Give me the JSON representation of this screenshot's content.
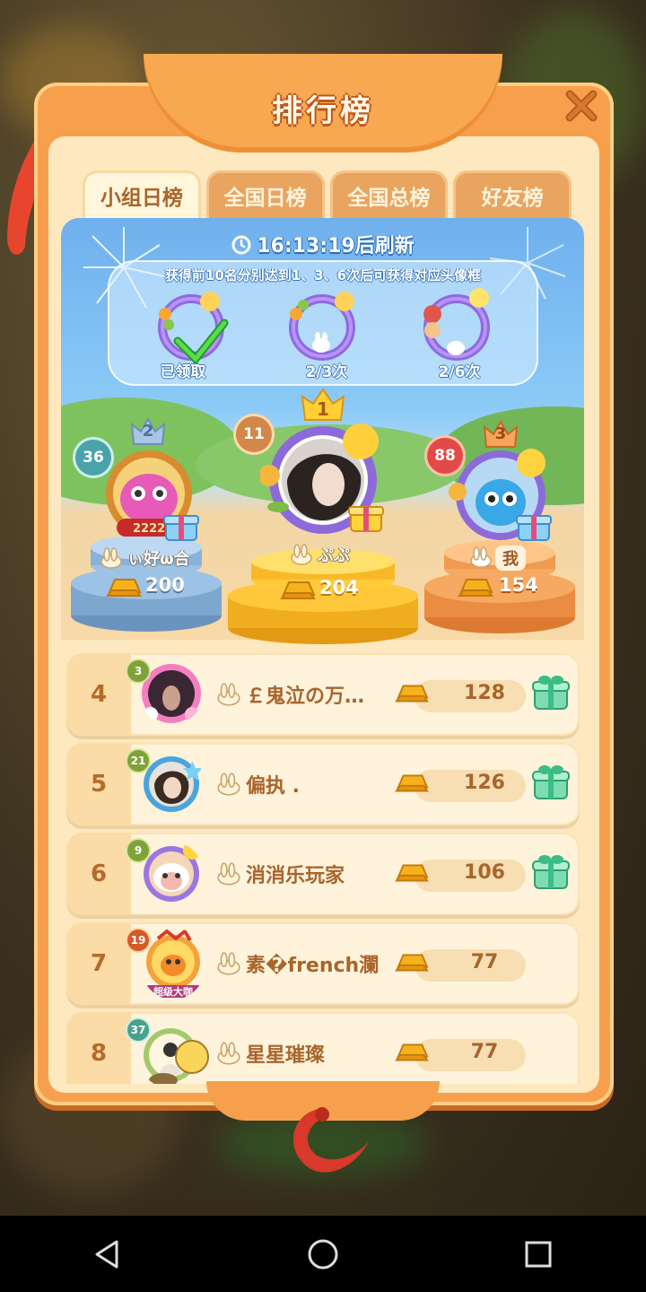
{
  "title": "排行榜",
  "tabs": [
    {
      "label": "小组日榜",
      "active": true
    },
    {
      "label": "全国日榜",
      "active": false
    },
    {
      "label": "全国总榜",
      "active": false
    },
    {
      "label": "好友榜",
      "active": false
    }
  ],
  "timer": "16:13:19后刷新",
  "reward": {
    "description": "获得前10名分别达到1、3、6次后可获得对应头像框",
    "frames": [
      {
        "label": "已领取",
        "claimed": true
      },
      {
        "label": "2/3次",
        "claimed": false
      },
      {
        "label": "2/6次",
        "claimed": false
      }
    ]
  },
  "podium": [
    {
      "rank": "2",
      "level": "36",
      "name": "ぃ好ω合",
      "score": "200",
      "badge_text": "2222",
      "color": "#8fb4d8"
    },
    {
      "rank": "1",
      "level": "11",
      "name": "ぷぷ",
      "score": "204",
      "color": "#f5b52a"
    },
    {
      "rank": "3",
      "level": "88",
      "name": "我",
      "score": "154",
      "color": "#f19a4e"
    }
  ],
  "rows": [
    {
      "rank": "4",
      "level": "3",
      "name": "￡鬼泣の万…",
      "score": "128",
      "has_gift": true
    },
    {
      "rank": "5",
      "level": "21",
      "name": "偏执 .",
      "score": "126",
      "has_gift": true
    },
    {
      "rank": "6",
      "level": "9",
      "name": "消消乐玩家",
      "score": "106",
      "has_gift": true
    },
    {
      "rank": "7",
      "level": "19",
      "name": "素�french瀾",
      "score": "77",
      "has_gift": false,
      "avatar_text": "超级大咖"
    },
    {
      "rank": "8",
      "level": "37",
      "name": "星星璀璨",
      "score": "77",
      "has_gift": false
    }
  ],
  "colors": {
    "panel": "#f6a04d",
    "panel_inner": "#fde8bf",
    "text_brown": "#a8652c"
  }
}
